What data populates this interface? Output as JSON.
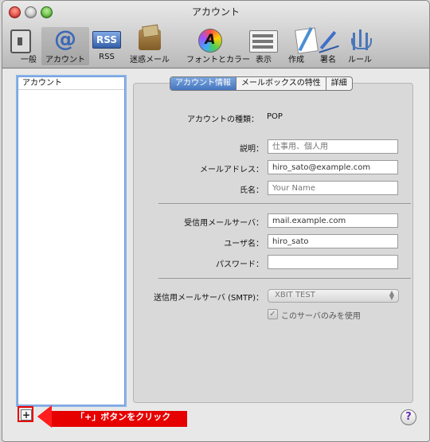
{
  "window": {
    "title": "アカウント"
  },
  "toolbar": {
    "items": [
      {
        "label": "一般",
        "icon": "general-icon"
      },
      {
        "label": "アカウント",
        "icon": "at-icon"
      },
      {
        "label": "RSS",
        "icon": "rss-icon"
      },
      {
        "label": "迷惑メール",
        "icon": "junk-mail-icon"
      },
      {
        "label": "フォントとカラー",
        "icon": "font-color-icon"
      },
      {
        "label": "表示",
        "icon": "view-icon"
      },
      {
        "label": "作成",
        "icon": "compose-icon"
      },
      {
        "label": "署名",
        "icon": "signature-icon"
      },
      {
        "label": "ルール",
        "icon": "rules-icon"
      }
    ],
    "rss_icon_text": "RSS"
  },
  "accounts_list": {
    "header": "アカウント"
  },
  "tabs": [
    {
      "label": "アカウント情報",
      "active": true
    },
    {
      "label": "メールボックスの特性",
      "active": false
    },
    {
      "label": "詳細",
      "active": false
    }
  ],
  "account_info": {
    "account_type_label": "アカウントの種類：",
    "account_type_value": "POP",
    "description_label": "説明：",
    "description_placeholder": "仕事用、個人用",
    "email_label": "メールアドレス：",
    "email_value": "hiro_sato@example.com",
    "full_name_label": "氏名：",
    "full_name_placeholder": "Your Name",
    "incoming_server_label": "受信用メールサーバ：",
    "incoming_server_value": "mail.example.com",
    "username_label": "ユーザ名：",
    "username_value": "hiro_sato",
    "password_label": "パスワード：",
    "password_value": "",
    "smtp_label": "送信用メールサーバ (SMTP)：",
    "smtp_value": "XBIT TEST",
    "use_only_server_label": "このサーバのみを使用",
    "use_only_server_checked": true,
    "check_mark": "✓"
  },
  "bottom": {
    "add_button": "+",
    "help_button": "?",
    "callout_text": "「+」ボタンをクリック"
  },
  "colors": {
    "highlight": "#e60000",
    "selection": "#4576bf",
    "callout": "#e60000"
  }
}
